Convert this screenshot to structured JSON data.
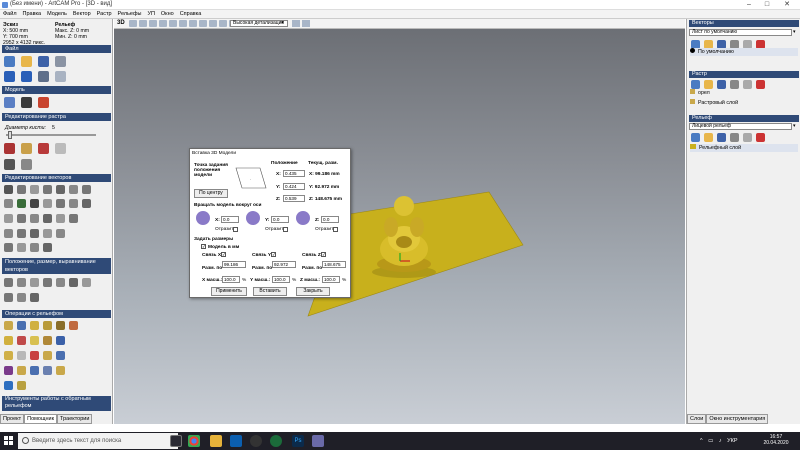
{
  "app": {
    "title": "(Без имени) - ArtCAM Pro - [3D - вид]",
    "min": "–",
    "max": "□",
    "close": "✕"
  },
  "menu": [
    "Файл",
    "Правка",
    "Модель",
    "Вектор",
    "Растр",
    "Рельефы",
    "УП",
    "Окно",
    "Справка"
  ],
  "left": {
    "info": {
      "sketch": "Эскиз",
      "x": "X: 500 mm",
      "y": "Y: 700 mm",
      "px": "2952 x 4132 пикс.",
      "relief": "Рельеф",
      "max": "Макс. Z: 0 mm",
      "min": "Мин. Z: 0 mm"
    },
    "sections": {
      "file": "Файл",
      "model": "Модель",
      "raster": "Редактирование растра",
      "vectors": "Редактирование векторов",
      "position": "Положение, размер, выравнивание векторов",
      "relief_ops": "Операции с рельефом",
      "reverse": "Инструменты работы с обратным рельефом"
    },
    "brush_label": "Диаметр кисти:",
    "brush_value": "5",
    "tabs": [
      "Проект",
      "Помощник",
      "Траектории"
    ]
  },
  "toolbar": {
    "view": "3D",
    "detail": "Высокая детализация"
  },
  "right": {
    "vectors_header": "Векторы",
    "vectors_select": "Лист по умолчанию",
    "vectors_item": "По умолчанию",
    "raster_header": "Растр",
    "raster_item1": "орел",
    "raster_item2": "Растровый слой",
    "relief_header": "Рельеф",
    "relief_select": "Лицевой рельеф",
    "relief_item": "Рельефный слой",
    "tabs": [
      "Слои",
      "Окно инструментария"
    ]
  },
  "dialog": {
    "title": "Вставка 3D Модели",
    "point_label": "Точка задания положения модели",
    "center_btn": "По центру",
    "pos_header": "Положение",
    "cur_header": "Текущ. разм.",
    "x_lbl": "X:",
    "y_lbl": "Y:",
    "z_lbl": "Z:",
    "pos_x": "0.435",
    "pos_y": "0.424",
    "pos_z": "0.539",
    "cur_x": "X: 99.186 mm",
    "cur_y": "Y: 92.972 mm",
    "cur_z": "Z: 148.675 mm",
    "rotate_label": "Вращать модель вокруг оси",
    "rot_x": "0.0",
    "rot_y": "0.0",
    "rot_z": "0.0",
    "mirror": "Отразить",
    "size_label": "Задать размеры",
    "model_mm": "Модель в мм",
    "link_x": "Связь X:",
    "link_y": "Связь Y:",
    "link_z": "Связь Z:",
    "size_lbl": "Разм. по",
    "size_x": "99.186",
    "size_y": "92.972",
    "size_z": "148.675",
    "scale_x_lbl": "X масш.:",
    "scale_y_lbl": "Y масш.:",
    "scale_z_lbl": "Z масш.:",
    "scale_x": "100.0",
    "scale_y": "100.0",
    "scale_z": "100.0",
    "pct": "%",
    "apply": "Применить",
    "insert": "Вставить",
    "close": "Закрыть"
  },
  "taskbar": {
    "search": "Введите здесь текст для поиска",
    "lang": "УКР",
    "time": "16:57",
    "date": "20.04.2020"
  },
  "colors": {
    "accent_header": "#2f4a77",
    "relief_gold": "#c9b41c",
    "viewport_top": "#6c6f75"
  }
}
